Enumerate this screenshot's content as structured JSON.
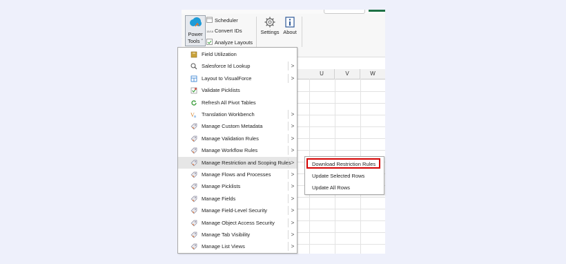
{
  "ribbon": {
    "power_tools_label_1": "Power",
    "power_tools_label_2": "Tools ˇ",
    "scheduler": "Scheduler",
    "convert_ids": "Convert IDs",
    "convert_ids_icon_text": "15/18",
    "analyze_layouts": "Analyze Layouts",
    "settings": "Settings",
    "about": "About"
  },
  "grid": {
    "columns": [
      "U",
      "V",
      "W"
    ]
  },
  "menu": {
    "items": [
      {
        "label": "Field Utilization",
        "icon": "field-utilization-icon",
        "submenu": false
      },
      {
        "label": "Salesforce Id Lookup",
        "icon": "search-icon",
        "submenu": true
      },
      {
        "label": "Layout to VisualForce",
        "icon": "layout-icon",
        "submenu": true
      },
      {
        "label": "Validate Picklists",
        "icon": "validate-picklists-icon",
        "submenu": false
      },
      {
        "label": "Refresh All Pivot Tables",
        "icon": "refresh-icon",
        "submenu": false
      },
      {
        "label": "Translation Workbench",
        "icon": "translation-icon",
        "submenu": true
      },
      {
        "label": "Manage Custom Metadata",
        "icon": "tag-icon",
        "submenu": true
      },
      {
        "label": "Manage Validation Rules",
        "icon": "tag-icon",
        "submenu": true
      },
      {
        "label": "Manage Workflow Rules",
        "icon": "tag-icon",
        "submenu": true
      },
      {
        "label": "Manage Restriction and Scoping Rules",
        "icon": "tag-icon",
        "submenu": true
      },
      {
        "label": "Manage Flows and Processes",
        "icon": "tag-icon",
        "submenu": true
      },
      {
        "label": "Manage Picklists",
        "icon": "tag-icon",
        "submenu": true
      },
      {
        "label": "Manage Fields",
        "icon": "tag-icon",
        "submenu": true
      },
      {
        "label": "Manage Field-Level Security",
        "icon": "tag-icon",
        "submenu": true
      },
      {
        "label": "Manage Object Access Security",
        "icon": "tag-icon",
        "submenu": true
      },
      {
        "label": "Manage Tab Visibility",
        "icon": "tag-icon",
        "submenu": true
      },
      {
        "label": "Manage List Views",
        "icon": "tag-icon",
        "submenu": true
      }
    ],
    "arrow_glyph": ">"
  },
  "submenu": {
    "items": [
      {
        "label": "Download Restriction Rules"
      },
      {
        "label": "Update Selected Rows"
      },
      {
        "label": "Update All Rows"
      }
    ]
  },
  "colors": {
    "highlight_border": "#d40000",
    "cloud_blue": "#1e9bd7",
    "brand_green": "#1e7145"
  }
}
